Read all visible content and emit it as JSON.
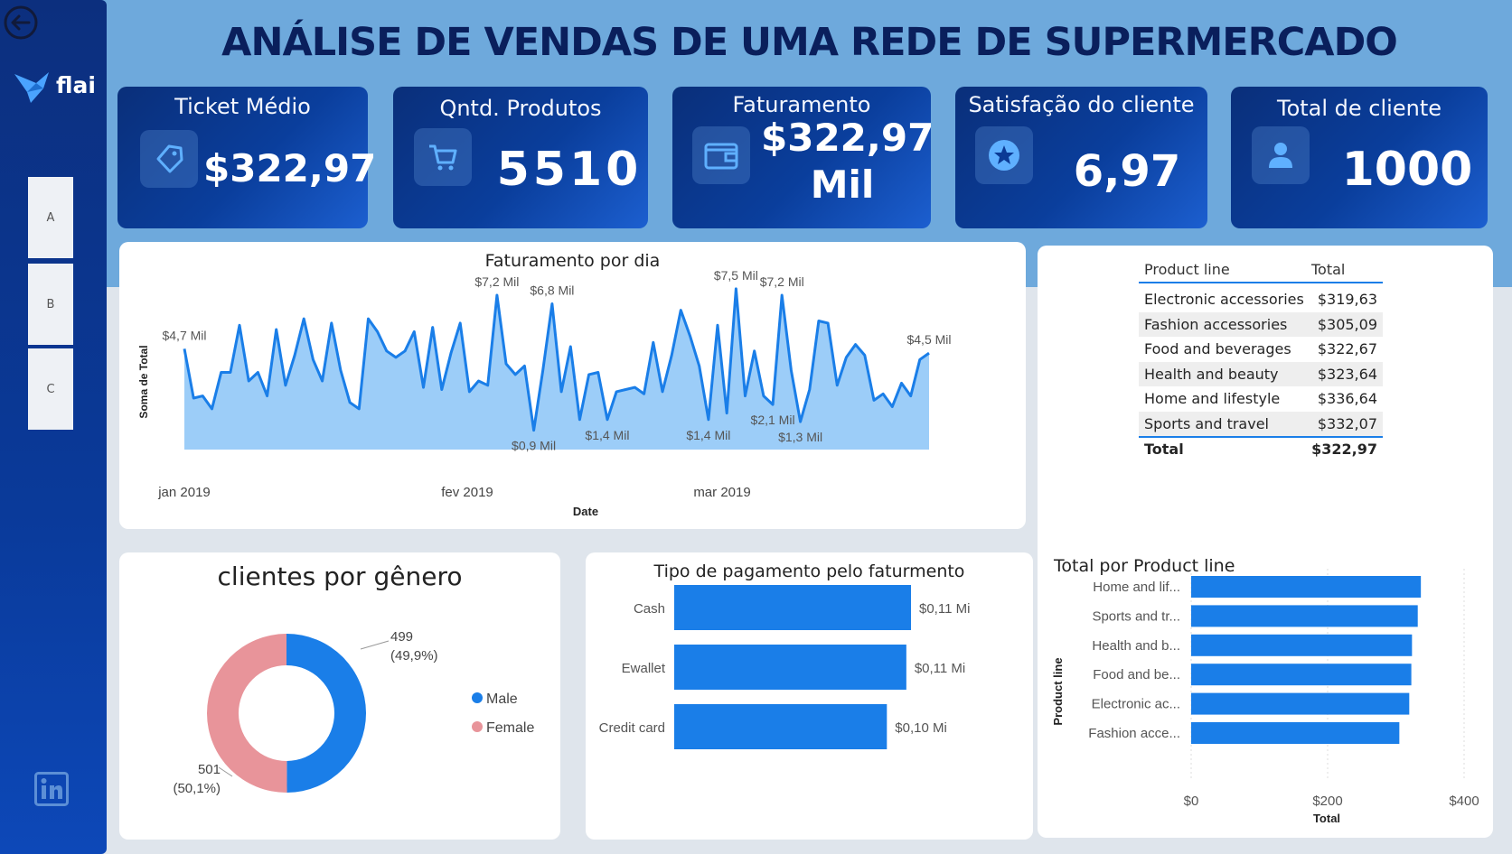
{
  "title": "ANÁLISE DE VENDAS DE UMA REDE DE SUPERMERCADO",
  "sidebar": {
    "logo_text": "flai",
    "nav": [
      "A",
      "B",
      "C"
    ]
  },
  "kpis": [
    {
      "label": "Ticket Médio",
      "value": "$322,97",
      "icon": "tag-icon"
    },
    {
      "label": "Qntd. Produtos",
      "value": "5510",
      "icon": "cart-icon"
    },
    {
      "label": "Faturamento",
      "value_line1": "$322,97",
      "value_line2": "Mil",
      "icon": "wallet-icon"
    },
    {
      "label": "Satisfação do cliente",
      "value": "6,97",
      "icon": "star-icon"
    },
    {
      "label": "Total de cliente",
      "value": "1000",
      "icon": "user-icon"
    }
  ],
  "line_chart": {
    "title": "Faturamento por dia",
    "xlabel": "Date",
    "ylabel": "Soma de Total",
    "x_ticks": [
      "jan 2019",
      "fev 2019",
      "mar 2019"
    ],
    "labels": [
      "$4,7 Mil",
      "$7,2 Mil",
      "$6,8 Mil",
      "$0,9 Mil",
      "$1,4 Mil",
      "$7,5 Mil",
      "$1,4 Mil",
      "$2,1 Mil",
      "$7,2 Mil",
      "$1,3 Mil",
      "$4,5 Mil"
    ]
  },
  "product_table": {
    "headers": [
      "Product line",
      "Total"
    ],
    "rows": [
      [
        "Electronic accessories",
        "$319,63"
      ],
      [
        "Fashion accessories",
        "$305,09"
      ],
      [
        "Food and beverages",
        "$322,67"
      ],
      [
        "Health and beauty",
        "$323,64"
      ],
      [
        "Home and lifestyle",
        "$336,64"
      ],
      [
        "Sports and travel",
        "$332,07"
      ]
    ],
    "total": [
      "Total",
      "$322,97"
    ]
  },
  "donut": {
    "title": "clientes por gênero",
    "legend": [
      "Male",
      "Female"
    ],
    "male_label": [
      "499",
      "(49,9%)"
    ],
    "female_label": [
      "501",
      "(50,1%)"
    ]
  },
  "payment_chart": {
    "title": "Tipo de pagamento pelo faturmento"
  },
  "hbar_chart": {
    "title": "Total por Product line",
    "ylabel": "Product line",
    "xlabel": "Total",
    "x_ticks": [
      "$0",
      "$200",
      "$400"
    ]
  },
  "colors": {
    "accent": "#1a7ee8",
    "line_fill": "#9ccdf8",
    "male": "#1a7ee8",
    "female": "#e8949a",
    "title": "#0a1f5c"
  },
  "chart_data": [
    {
      "type": "area",
      "title": "Faturamento por dia",
      "xlabel": "Date",
      "ylabel": "Soma de Total",
      "x_range": [
        "2019-01-01",
        "2019-03-30"
      ],
      "values_mil": [
        4.7,
        2.4,
        2.5,
        1.9,
        3.6,
        3.6,
        5.8,
        3.2,
        3.6,
        2.5,
        5.6,
        3.0,
        4.4,
        6.1,
        4.2,
        3.2,
        5.9,
        3.7,
        2.2,
        1.9,
        6.1,
        5.5,
        4.6,
        4.3,
        4.6,
        5.5,
        2.9,
        5.7,
        2.8,
        4.5,
        5.9,
        2.7,
        3.2,
        3.0,
        7.2,
        4.0,
        3.5,
        3.9,
        0.9,
        3.7,
        6.8,
        2.7,
        4.8,
        1.4,
        3.5,
        3.6,
        1.4,
        2.7,
        2.8,
        2.9,
        2.6,
        5.0,
        2.7,
        4.4,
        6.5,
        5.3,
        3.9,
        1.4,
        5.8,
        1.7,
        7.5,
        2.5,
        4.6,
        2.5,
        2.1,
        7.2,
        3.7,
        1.3,
        2.8,
        6.0,
        5.9,
        3.0,
        4.3,
        4.9,
        4.4,
        2.3,
        2.6,
        2.0,
        3.1,
        2.5,
        4.2,
        4.5
      ],
      "labels": [
        {
          "x": 0,
          "value": 4.7
        },
        {
          "x": 34,
          "value": 7.2
        },
        {
          "x": 40,
          "value": 6.8
        },
        {
          "x": 38,
          "value": 0.9
        },
        {
          "x": 46,
          "value": 1.4
        },
        {
          "x": 60,
          "value": 7.5
        },
        {
          "x": 57,
          "value": 1.4
        },
        {
          "x": 64,
          "value": 2.1
        },
        {
          "x": 65,
          "value": 7.2
        },
        {
          "x": 67,
          "value": 1.3
        },
        {
          "x": 81,
          "value": 4.5
        }
      ],
      "ylim": [
        0,
        8
      ]
    },
    {
      "type": "pie",
      "title": "clientes por gênero",
      "categories": [
        "Male",
        "Female"
      ],
      "values": [
        499,
        501
      ]
    },
    {
      "type": "bar",
      "title": "Tipo de pagamento pelo faturmento",
      "categories": [
        "Cash",
        "Ewallet",
        "Credit card"
      ],
      "values": [
        0.11,
        0.11,
        0.1
      ],
      "value_labels": [
        "$0,11 Mi",
        "$0,11 Mi",
        "$0,10 Mi"
      ],
      "raw_values": [
        112.2,
        109.99,
        100.77
      ]
    },
    {
      "type": "bar",
      "title": "Total por Product line",
      "xlabel": "Total",
      "ylabel": "Product line",
      "categories": [
        "Home and lif...",
        "Sports and tr...",
        "Health and b...",
        "Food and be...",
        "Electronic ac...",
        "Fashion acce..."
      ],
      "values": [
        336.64,
        332.07,
        323.64,
        322.67,
        319.63,
        305.09
      ],
      "xlim": [
        0,
        400
      ]
    }
  ]
}
